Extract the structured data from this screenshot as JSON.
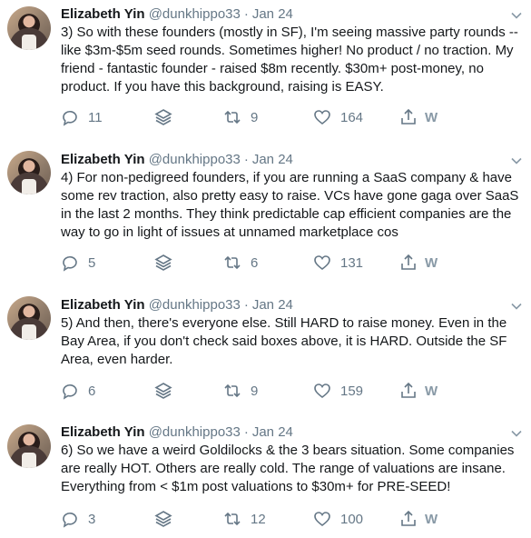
{
  "tweets": [
    {
      "author": "Elizabeth Yin",
      "handle": "@dunkhippo33",
      "separator": "·",
      "date": "Jan 24",
      "text": "3) So with these founders (mostly in SF), I'm seeing massive party rounds -- like $3m-$5m seed rounds.  Sometimes higher! No product / no traction. My friend - fantastic founder - raised $8m recently. $30m+ post-money, no product. If you have this background, raising is EASY.",
      "replies": "11",
      "retweets": "9",
      "likes": "164"
    },
    {
      "author": "Elizabeth Yin",
      "handle": "@dunkhippo33",
      "separator": "·",
      "date": "Jan 24",
      "text": "4) For non-pedigreed founders, if you are running a SaaS company & have some rev traction, also pretty easy to raise. VCs have gone gaga over SaaS in the last 2 months. They think predictable cap efficient companies are the way to go in light of issues at unnamed marketplace cos",
      "replies": "5",
      "retweets": "6",
      "likes": "131"
    },
    {
      "author": "Elizabeth Yin",
      "handle": "@dunkhippo33",
      "separator": "·",
      "date": "Jan 24",
      "text": "5) And then, there's everyone else. Still HARD to raise money. Even in the Bay Area, if you don't check said boxes above, it is HARD. Outside the SF Area, even harder.",
      "replies": "6",
      "retweets": "9",
      "likes": "159"
    },
    {
      "author": "Elizabeth Yin",
      "handle": "@dunkhippo33",
      "separator": "·",
      "date": "Jan 24",
      "text": "6) So we have a weird Goldilocks & the 3 bears situation. Some companies are really HOT. Others are really cold. The range of valuations are insane. Everything from < $1m post valuations to $30m+ for PRE-SEED!",
      "replies": "3",
      "retweets": "12",
      "likes": "100"
    }
  ],
  "icons": {
    "reply": "reply-icon",
    "stack": "layers-icon",
    "retweet": "retweet-icon",
    "like": "heart-icon",
    "share": "share-icon",
    "extension": "w-icon",
    "extension_label": "W",
    "more": "chevron-down-icon"
  },
  "colors": {
    "text": "#14171a",
    "muted": "#657786",
    "background": "#ffffff"
  }
}
